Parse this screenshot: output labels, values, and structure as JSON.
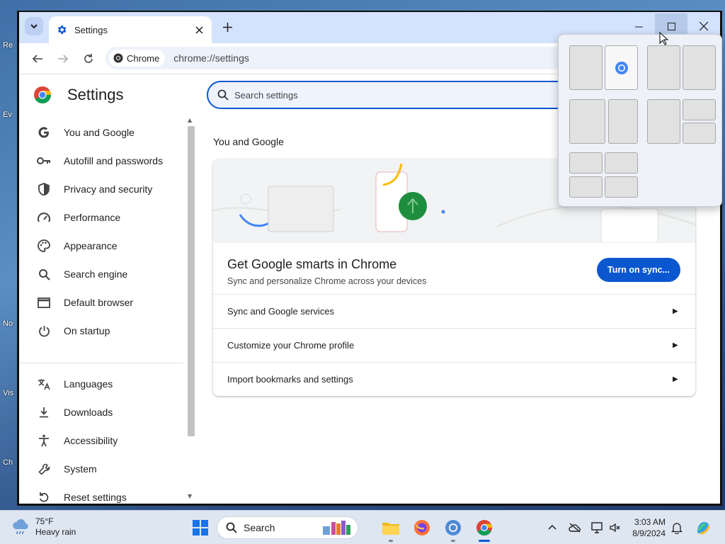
{
  "desktop": {
    "icon_labels": [
      "Re",
      "Ev",
      "No",
      "Vis",
      "Ch"
    ]
  },
  "browser": {
    "tab": {
      "title": "Settings"
    },
    "omnibox": {
      "chip_label": "Chrome",
      "url": "chrome://settings"
    }
  },
  "sidebar": {
    "title": "Settings",
    "items": [
      {
        "label": "You and Google",
        "icon": "google-g-icon"
      },
      {
        "label": "Autofill and passwords",
        "icon": "key-icon"
      },
      {
        "label": "Privacy and security",
        "icon": "shield-icon"
      },
      {
        "label": "Performance",
        "icon": "speedometer-icon"
      },
      {
        "label": "Appearance",
        "icon": "palette-icon"
      },
      {
        "label": "Search engine",
        "icon": "search-icon"
      },
      {
        "label": "Default browser",
        "icon": "browser-window-icon"
      },
      {
        "label": "On startup",
        "icon": "power-icon"
      },
      {
        "label": "Languages",
        "icon": "translate-icon"
      },
      {
        "label": "Downloads",
        "icon": "download-icon"
      },
      {
        "label": "Accessibility",
        "icon": "accessibility-icon"
      },
      {
        "label": "System",
        "icon": "wrench-icon"
      },
      {
        "label": "Reset settings",
        "icon": "reset-icon"
      }
    ]
  },
  "search": {
    "placeholder": "Search settings"
  },
  "main": {
    "section_title": "You and Google",
    "card": {
      "title": "Get Google smarts in Chrome",
      "subtitle": "Sync and personalize Chrome across your devices",
      "sync_button": "Turn on sync...",
      "rows": [
        {
          "label": "Sync and Google services"
        },
        {
          "label": "Customize your Chrome profile"
        },
        {
          "label": "Import bookmarks and settings"
        }
      ]
    }
  },
  "taskbar": {
    "weather": {
      "temp": "75°F",
      "condition": "Heavy rain"
    },
    "search_label": "Search",
    "clock": {
      "time": "3:03 AM",
      "date": "8/9/2024"
    }
  },
  "colors": {
    "accent": "#0b57d0",
    "tabbar": "#d3e3fd"
  }
}
